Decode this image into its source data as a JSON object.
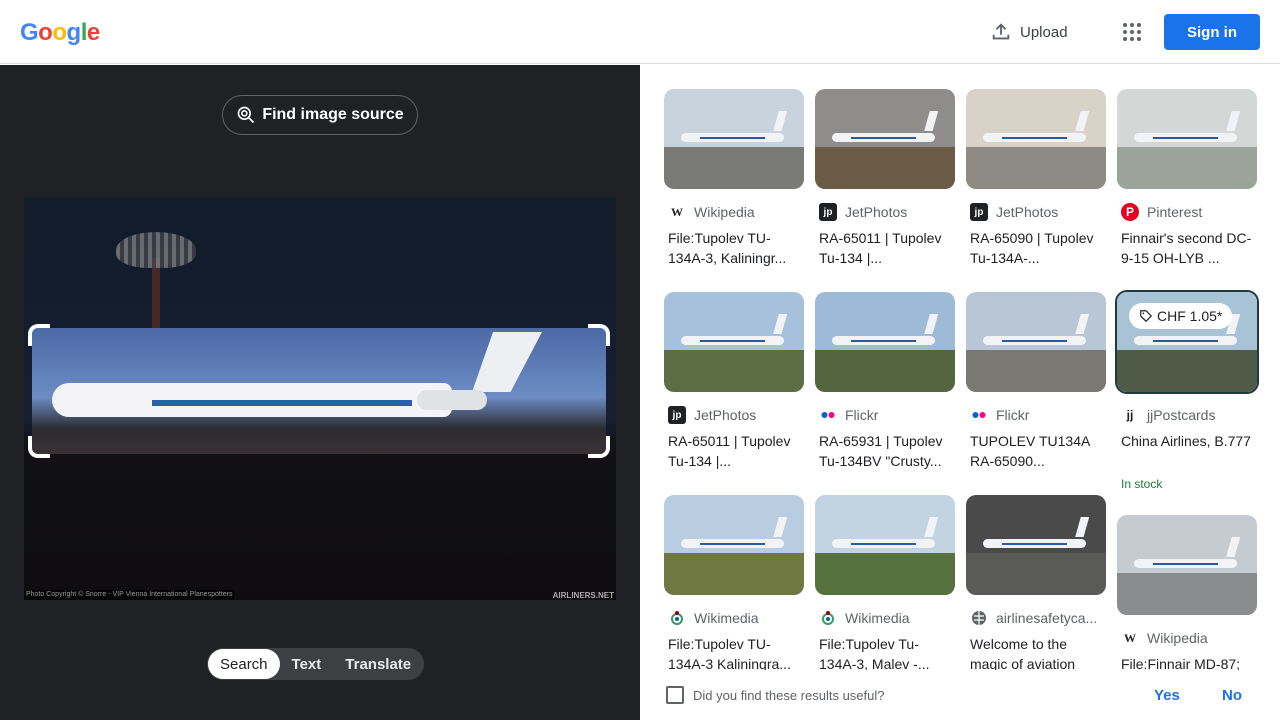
{
  "header": {
    "logo_letters": [
      {
        "ch": "G",
        "color": "#4285f4"
      },
      {
        "ch": "o",
        "color": "#ea4335"
      },
      {
        "ch": "o",
        "color": "#fbbc05"
      },
      {
        "ch": "g",
        "color": "#4285f4"
      },
      {
        "ch": "l",
        "color": "#34a853"
      },
      {
        "ch": "e",
        "color": "#ea4335"
      }
    ],
    "upload_label": "Upload",
    "apps_icon": "apps-grid-icon",
    "signin_label": "Sign in"
  },
  "left": {
    "find_source_label": "Find image source",
    "photo_copyright": "Photo Copyright © Snorre - VIP Vienna International Planespotters",
    "photo_watermark": "AIRLINERS.NET",
    "modes": [
      "Search",
      "Text",
      "Translate"
    ],
    "active_mode": "Search"
  },
  "results": [
    {
      "source": "Wikipedia",
      "icon": "wikipedia-icon",
      "title": "File:Tupolev TU-134A-3, Kaliningr...",
      "sky": "#c9d3dd",
      "ground": "#7a7a78"
    },
    {
      "source": "JetPhotos",
      "icon": "jetphotos-icon",
      "title": "RA-65011 | Tupolev Tu-134 |...",
      "sky": "#8f8c8c",
      "ground": "#6b5a45"
    },
    {
      "source": "JetPhotos",
      "icon": "jetphotos-icon",
      "title": "RA-65090 | Tupolev Tu-134A-...",
      "sky": "#d8d2c8",
      "ground": "#8e8a84"
    },
    {
      "source": "Pinterest",
      "icon": "pinterest-icon",
      "title": "Finnair's second DC-9-15 OH-LYB ...",
      "sky": "#d3d7d5",
      "ground": "#9aa49a"
    },
    {
      "source": "JetPhotos",
      "icon": "jetphotos-icon",
      "title": "RA-65011 | Tupolev Tu-134 |...",
      "sky": "#a7c0dc",
      "ground": "#5d6e45"
    },
    {
      "source": "Flickr",
      "icon": "flickr-icon",
      "title": "RA-65931 | Tupolev Tu-134BV \"Crusty...",
      "sky": "#9dbad6",
      "ground": "#55663f"
    },
    {
      "source": "Flickr",
      "icon": "flickr-icon",
      "title": "TUPOLEV TU134A RA-65090...",
      "sky": "#b9c6d6",
      "ground": "#7a7872"
    },
    {
      "source": "jjPostcards",
      "icon": "jjpostcards-icon",
      "title": "China Airlines, B.777",
      "sky": "#a9c3d6",
      "ground": "#4f5b47",
      "price": "CHF 1.05*",
      "stock": "In stock"
    },
    {
      "source": "Wikimedia",
      "icon": "wikimedia-icon",
      "title": "File:Tupolev TU-134A-3 Kaliningra...",
      "sky": "#b8cde0",
      "ground": "#6f7840"
    },
    {
      "source": "Wikimedia",
      "icon": "wikimedia-icon",
      "title": "File:Tupolev Tu-134A-3, Malev -...",
      "sky": "#c2d4e2",
      "ground": "#57713e"
    },
    {
      "source": "airlinesafetyca...",
      "icon": "globe-icon",
      "title": "Welcome to the magic of aviation",
      "sky": "#4a4a4a",
      "ground": "#5a5a58"
    },
    {
      "source": "Wikipedia",
      "icon": "wikipedia-icon",
      "title": "File:Finnair MD-87;",
      "sky": "#c6cbd2",
      "ground": "#8a8c8e"
    }
  ],
  "feedback": {
    "question": "Did you find these results useful?",
    "yes": "Yes",
    "no": "No"
  }
}
